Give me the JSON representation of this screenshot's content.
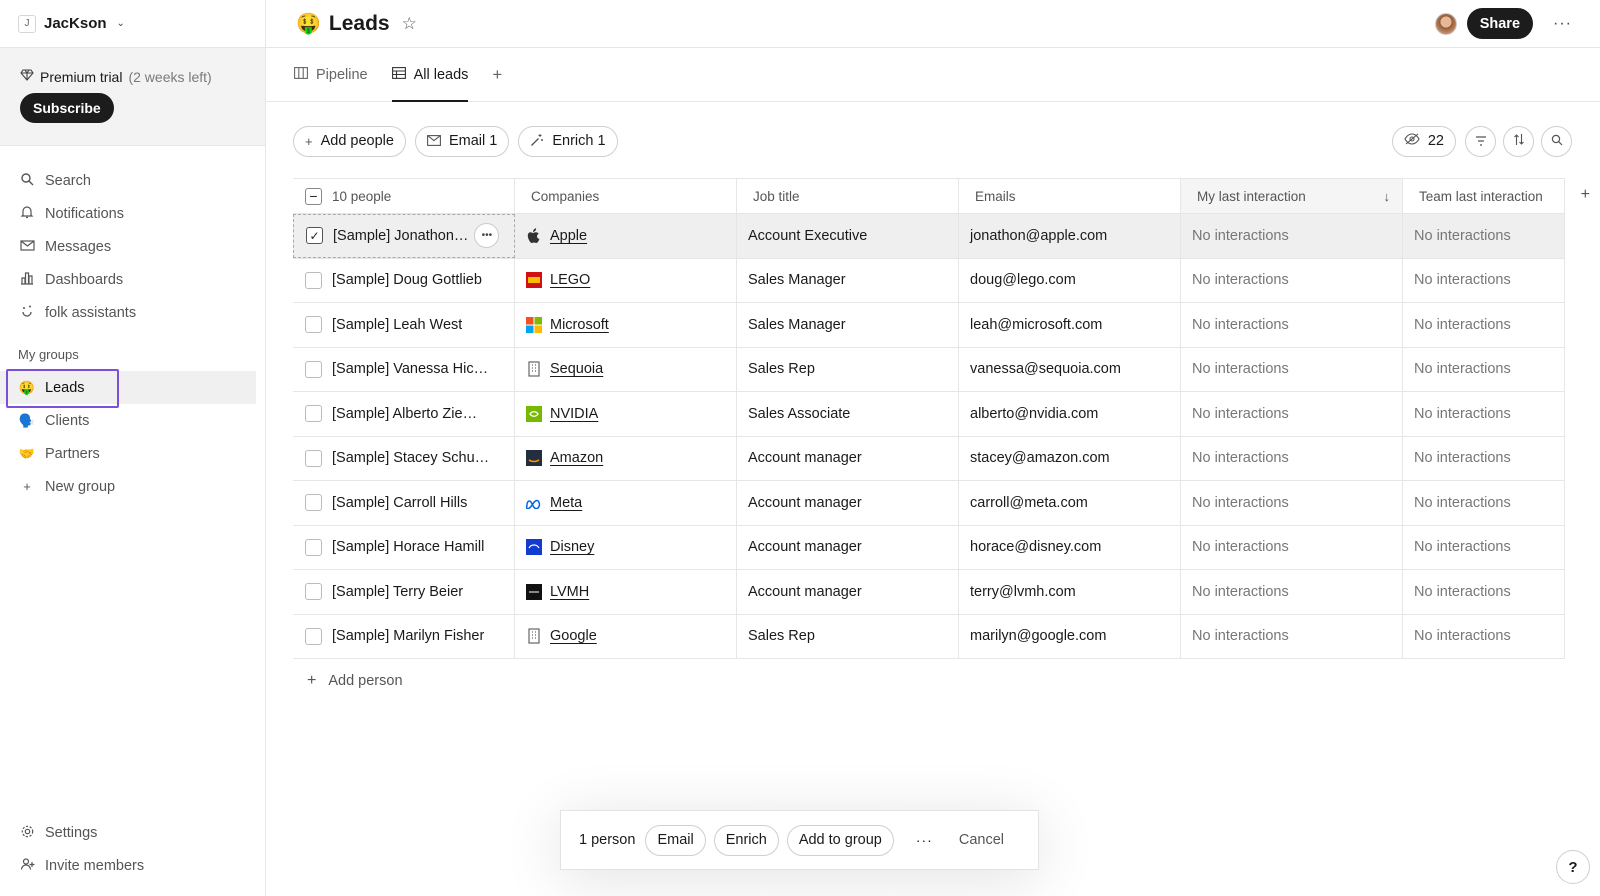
{
  "workspace": {
    "initial": "J",
    "name": "JacKson"
  },
  "trial": {
    "label": "Premium trial",
    "remaining": "(2 weeks left)",
    "subscribe_label": "Subscribe"
  },
  "nav": [
    {
      "label": "Search",
      "icon": "search-icon"
    },
    {
      "label": "Notifications",
      "icon": "bell-icon"
    },
    {
      "label": "Messages",
      "icon": "mail-icon"
    },
    {
      "label": "Dashboards",
      "icon": "chart-icon"
    },
    {
      "label": "folk assistants",
      "icon": "assistant-icon"
    }
  ],
  "groups": {
    "title": "My groups",
    "items": [
      {
        "label": "Leads",
        "emoji": "🤑",
        "active": true
      },
      {
        "label": "Clients",
        "emoji": "🗣️"
      },
      {
        "label": "Partners",
        "emoji": "🤝"
      },
      {
        "label": "New group",
        "emoji": "+"
      }
    ]
  },
  "bottom_nav": [
    {
      "label": "Settings",
      "icon": "gear-icon"
    },
    {
      "label": "Invite members",
      "icon": "add-user-icon"
    }
  ],
  "header": {
    "emoji": "🤑",
    "title": "Leads",
    "share_label": "Share"
  },
  "tabs": [
    {
      "label": "Pipeline",
      "active": false
    },
    {
      "label": "All leads",
      "active": true
    }
  ],
  "toolbar": {
    "add_people": "Add people",
    "email": "Email 1",
    "enrich": "Enrich 1",
    "hidden_count": "22"
  },
  "table": {
    "columns": [
      "10 people",
      "Companies",
      "Job title",
      "Emails",
      "My last interaction",
      "Team last interaction"
    ],
    "rows": [
      {
        "name": "[Sample] Jonathon…",
        "company": "Apple",
        "logo_color": "#333333",
        "job": "Account Executive",
        "email": "jonathon@apple.com",
        "my": "No interactions",
        "team": "No interactions",
        "selected": true
      },
      {
        "name": "[Sample] Doug Gottlieb",
        "company": "LEGO",
        "logo_color": "#d01012",
        "job": "Sales Manager",
        "email": "doug@lego.com",
        "my": "No interactions",
        "team": "No interactions"
      },
      {
        "name": "[Sample] Leah West",
        "company": "Microsoft",
        "logo_color": "#f25022",
        "job": "Sales Manager",
        "email": "leah@microsoft.com",
        "my": "No interactions",
        "team": "No interactions"
      },
      {
        "name": "[Sample] Vanessa Hic…",
        "company": "Sequoia",
        "logo_color": "#666666",
        "job": "Sales Rep",
        "email": "vanessa@sequoia.com",
        "my": "No interactions",
        "team": "No interactions"
      },
      {
        "name": "[Sample] Alberto Zie…",
        "company": "NVIDIA",
        "logo_color": "#76b900",
        "job": "Sales Associate",
        "email": "alberto@nvidia.com",
        "my": "No interactions",
        "team": "No interactions"
      },
      {
        "name": "[Sample] Stacey Schu…",
        "company": "Amazon",
        "logo_color": "#232f3e",
        "job": "Account manager",
        "email": "stacey@amazon.com",
        "my": "No interactions",
        "team": "No interactions"
      },
      {
        "name": "[Sample] Carroll Hills",
        "company": "Meta",
        "logo_color": "#0668e1",
        "job": "Account manager",
        "email": "carroll@meta.com",
        "my": "No interactions",
        "team": "No interactions"
      },
      {
        "name": "[Sample] Horace Hamill",
        "company": "Disney",
        "logo_color": "#113ccf",
        "job": "Account manager",
        "email": "horace@disney.com",
        "my": "No interactions",
        "team": "No interactions"
      },
      {
        "name": "[Sample] Terry Beier",
        "company": "LVMH",
        "logo_color": "#111111",
        "job": "Account manager",
        "email": "terry@lvmh.com",
        "my": "No interactions",
        "team": "No interactions"
      },
      {
        "name": "[Sample] Marilyn Fisher",
        "company": "Google",
        "logo_color": "#666666",
        "job": "Sales Rep",
        "email": "marilyn@google.com",
        "my": "No interactions",
        "team": "No interactions"
      }
    ],
    "add_person_label": "Add person"
  },
  "actionbar": {
    "count": "1 person",
    "email": "Email",
    "enrich": "Enrich",
    "add_to_group": "Add to group",
    "cancel": "Cancel"
  },
  "help_label": "?",
  "colors": {
    "accent_outline": "#7b4fd6",
    "dark_button": "#1c1c1c"
  }
}
